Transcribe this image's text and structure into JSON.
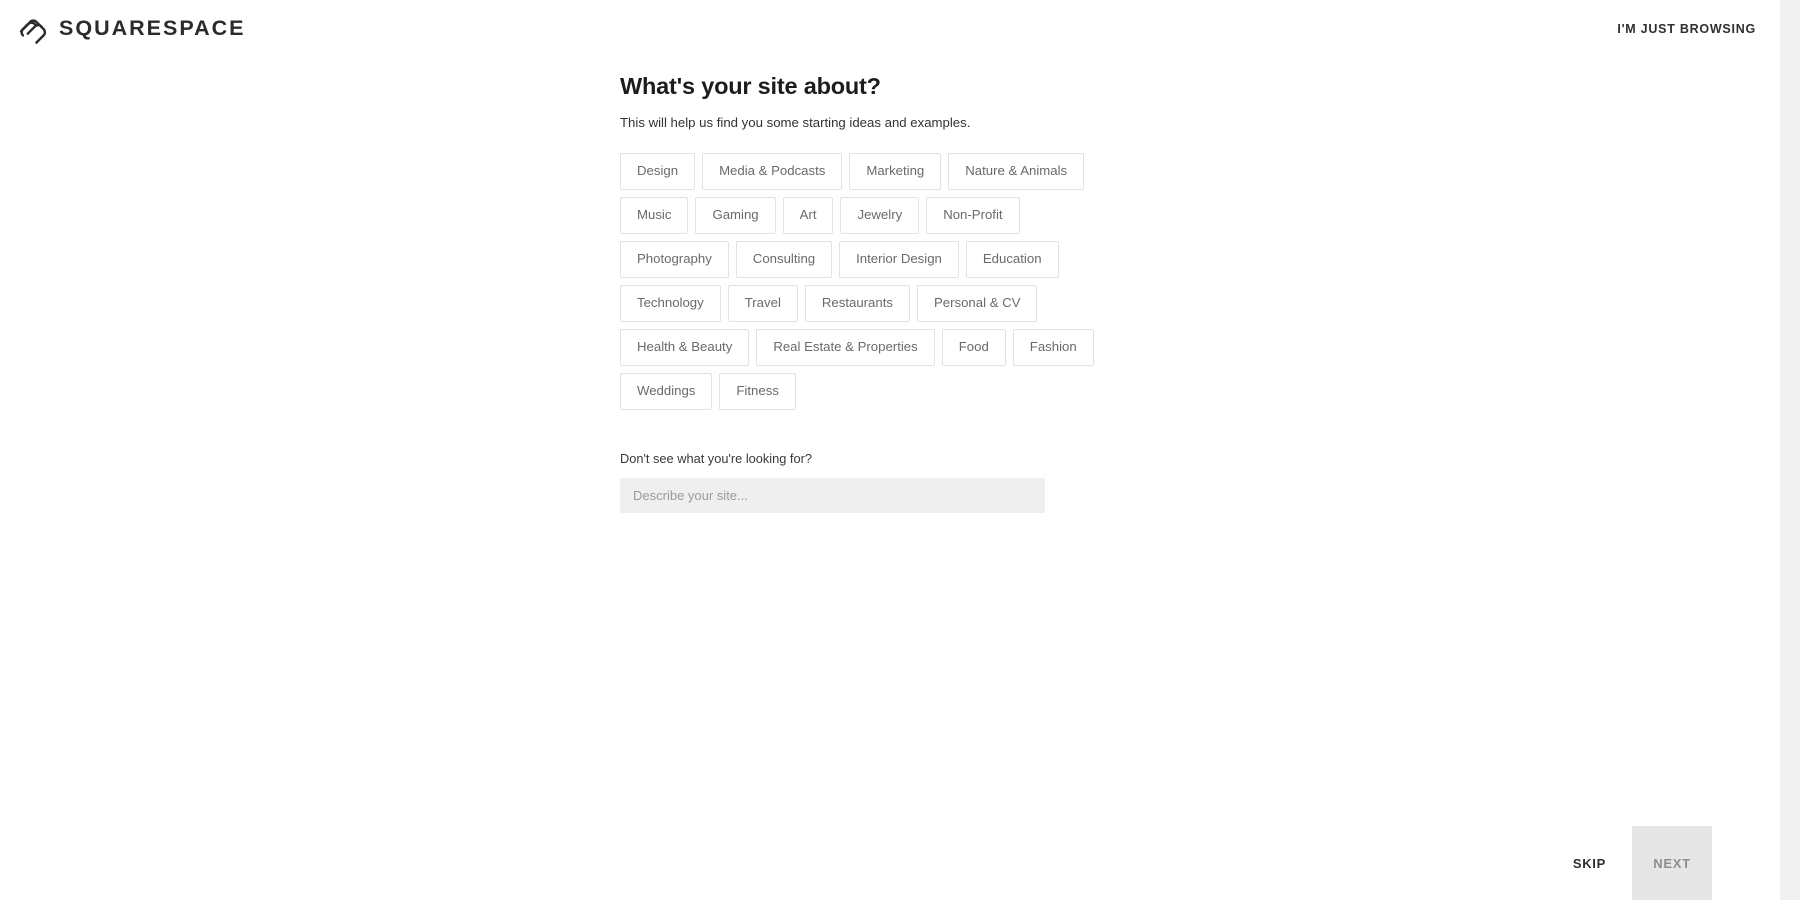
{
  "header": {
    "brand_name": "SQUARESPACE",
    "brand_mark_icon": "squarespace-logo-icon",
    "browsing_label": "I'M JUST BROWSING"
  },
  "main": {
    "title": "What's your site about?",
    "subtitle": "This will help us find you some starting ideas and examples.",
    "category_rows": [
      [
        "Design",
        "Media & Podcasts",
        "Marketing",
        "Nature & Animals"
      ],
      [
        "Music",
        "Gaming",
        "Art",
        "Jewelry",
        "Non-Profit"
      ],
      [
        "Photography",
        "Consulting",
        "Interior Design",
        "Education"
      ],
      [
        "Technology",
        "Travel",
        "Restaurants",
        "Personal & CV"
      ],
      [
        "Health & Beauty",
        "Real Estate & Properties",
        "Food",
        "Fashion"
      ],
      [
        "Weddings",
        "Fitness"
      ]
    ],
    "describe": {
      "label": "Don't see what you're looking for?",
      "placeholder": "Describe your site...",
      "value": ""
    }
  },
  "footer": {
    "skip_label": "SKIP",
    "next_label": "NEXT"
  },
  "colors": {
    "page_background": "#ffffff",
    "text_primary": "#1c1c1c",
    "text_secondary": "#333333",
    "chip_border": "#e2e2e2",
    "chip_text": "#6a6a6a",
    "input_background": "#efefef",
    "next_button_background": "#e6e6e6",
    "next_button_text": "#8e8e8e",
    "scrollbar_track": "#f1f1f1"
  }
}
